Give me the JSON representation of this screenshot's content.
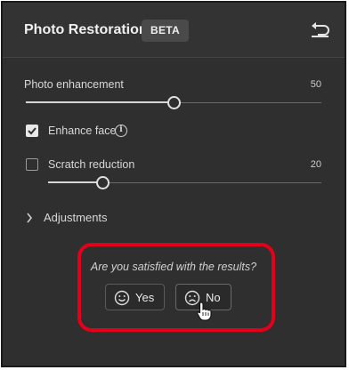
{
  "header": {
    "title": "Photo Restoration",
    "badge": "BETA"
  },
  "photo_enhancement": {
    "label": "Photo enhancement",
    "value": "50",
    "level_percent": 50
  },
  "enhance_face": {
    "label": "Enhance face",
    "checked": true
  },
  "scratch_reduction": {
    "label": "Scratch reduction",
    "checked": false,
    "value": "20",
    "level_percent": 20
  },
  "adjustments": {
    "label": "Adjustments"
  },
  "feedback": {
    "question": "Are you satisfied with the results?",
    "yes_label": "Yes",
    "no_label": "No"
  },
  "colors": {
    "panel_bg": "#2f2f2f",
    "highlight": "#e3001b"
  }
}
